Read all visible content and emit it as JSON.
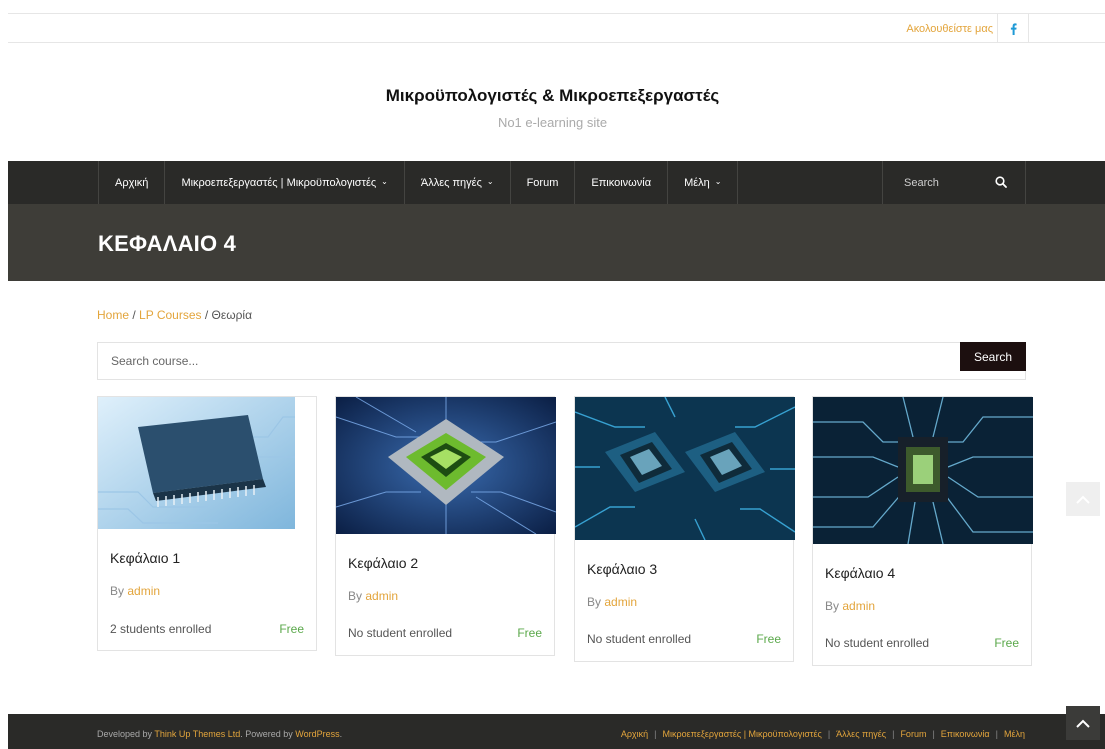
{
  "topbar": {
    "follow_text": "Ακολουθείστε μας",
    "facebook_icon": "facebook-icon",
    "accent_color": "#e3a53c"
  },
  "header": {
    "site_title": "Μικροϋπολογιστές & Μικροεπεξεργαστές",
    "tagline": "No1 e-learning site"
  },
  "nav": {
    "items": [
      {
        "label": "Αρχική",
        "dropdown": false
      },
      {
        "label": "Μικροεπεξεργαστές | Μικροϋπολογιστές",
        "dropdown": true
      },
      {
        "label": "Άλλες πηγές",
        "dropdown": true
      },
      {
        "label": "Forum",
        "dropdown": false
      },
      {
        "label": "Επικοινωνία",
        "dropdown": false
      },
      {
        "label": "Μέλη",
        "dropdown": true
      }
    ],
    "search_placeholder": "Search",
    "search_icon": "search-icon"
  },
  "page": {
    "title": "ΚΕΦΑΛΑΙΟ 4"
  },
  "breadcrumb": {
    "home": "Home",
    "sep1": " / ",
    "courses": "LP Courses",
    "sep2": " / ",
    "current": "Θεωρία"
  },
  "course_search": {
    "placeholder": "Search course...",
    "button": "Search"
  },
  "courses": [
    {
      "title": "Κεφάλαιο 1",
      "by": "By ",
      "author": "admin",
      "enrolled": "2 students enrolled",
      "price": "Free",
      "image": "microchip-photo"
    },
    {
      "title": "Κεφάλαιο 2",
      "by": "By ",
      "author": "admin",
      "enrolled": "No student enrolled",
      "price": "Free",
      "image": "green-cpu-photo"
    },
    {
      "title": "Κεφάλαιο 3",
      "by": "By ",
      "author": "admin",
      "enrolled": "No student enrolled",
      "price": "Free",
      "image": "dual-chip-photo"
    },
    {
      "title": "Κεφάλαιο 4",
      "by": "By ",
      "author": "admin",
      "enrolled": "No student enrolled",
      "price": "Free",
      "image": "circuit-chip-photo"
    }
  ],
  "footer": {
    "developed_by": "Developed by ",
    "theme_link": "Think Up Themes Ltd",
    "powered_by": ". Powered by ",
    "wp_link": "WordPress",
    "end": ".",
    "menu": [
      "Αρχική",
      "Μικροεπεξεργαστές | Μικροϋπολογιστές",
      "Άλλες πηγές",
      "Forum",
      "Επικοινωνία",
      "Μέλη"
    ],
    "separator": "|"
  },
  "colors": {
    "nav_bg": "#2a2a28",
    "title_band": "#3e3d38",
    "price_green": "#5aa84a",
    "accent": "#e3a53c"
  }
}
